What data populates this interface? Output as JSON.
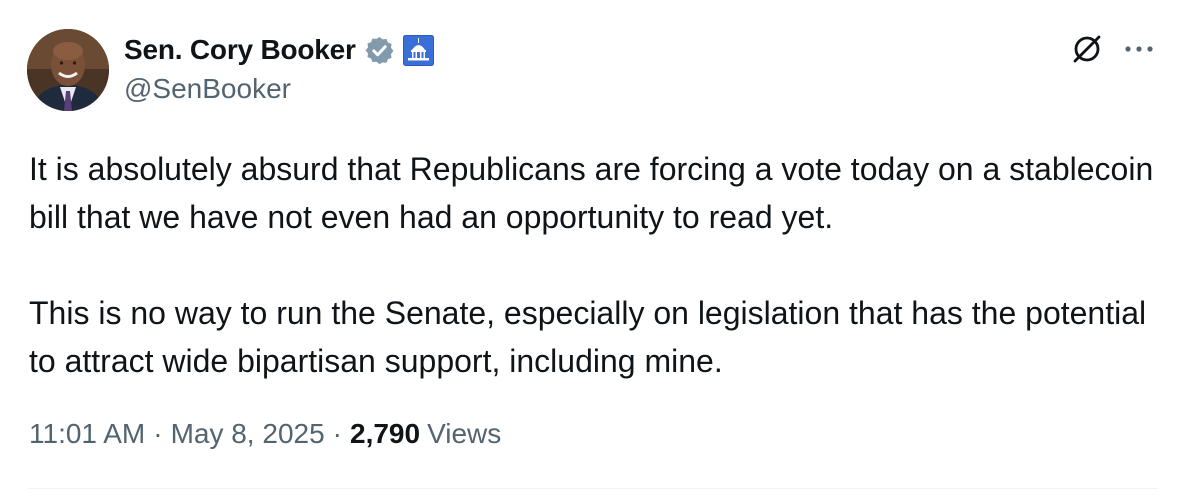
{
  "author": {
    "name": "Sen. Cory Booker",
    "handle": "@SenBooker",
    "verified_icon": "verified-badge-icon",
    "affiliation_icon": "us-capitol-icon"
  },
  "tweet": {
    "paragraphs": [
      "It is absolutely absurd that Republicans are forcing a vote today on a stablecoin bill that we have not even had an opportunity to read yet.",
      "This is no way to run the Senate, especially on legislation that has the potential to attract wide bipartisan support, including mine."
    ]
  },
  "meta": {
    "time": "11:01 AM",
    "separator": "·",
    "date": "May 8, 2025",
    "views_count": "2,790",
    "views_label": "Views"
  },
  "colors": {
    "text": "#0f1419",
    "secondary": "#536471",
    "verified": "#829aab",
    "affiliation_bg": "#3a6fd8"
  }
}
